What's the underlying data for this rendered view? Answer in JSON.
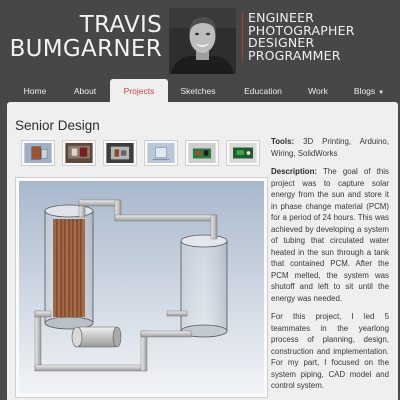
{
  "header": {
    "name_first": "TRAVIS",
    "name_last": "BUMGARNER",
    "roles": [
      "ENGINEER",
      "PHOTOGRAPHER",
      "DESIGNER",
      "PROGRAMMER"
    ],
    "accent_color": "#a73a3a"
  },
  "nav": {
    "items": [
      "Home",
      "About",
      "Projects",
      "Sketches",
      "Education",
      "Work",
      "Blogs"
    ],
    "active": "Projects",
    "active_color": "#c04848"
  },
  "page": {
    "title": "Senior Design",
    "tools_label": "Tools:",
    "tools_text": "3D Printing, Arduino, Wiring, SolidWorks",
    "description_label": "Description:",
    "description_text": "The goal of this project was to capture solar energy from the sun and store it in phase change material (PCM) for a period of 24 hours. This was achieved by developing a system of tubing that circulated water heated in the sun through a tank that contained PCM. After the PCM melted, the system was shutoff and left to sit until the energy was needed.",
    "paragraph2": "For this project, I led 5 teammates in the yearlong process of planning, design, construction and implementation. For my part, I focused on the system piping, CAD model and control system."
  }
}
